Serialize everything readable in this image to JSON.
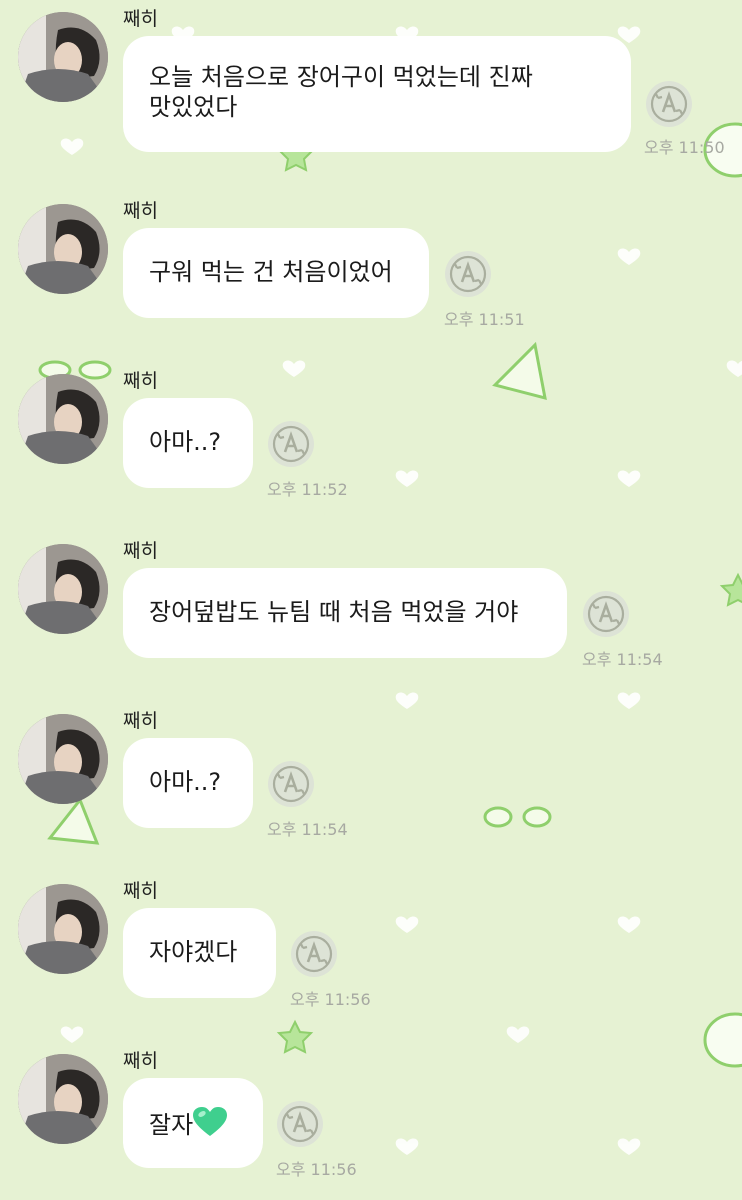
{
  "chat": {
    "messages": [
      {
        "sender": "째히",
        "text_lines": [
          "오늘 처음으로 장어구이 먹었는데 진짜",
          "맛있었다"
        ],
        "time": "오후 11:50"
      },
      {
        "sender": "째히",
        "text_lines": [
          "구워 먹는 건 처음이었어"
        ],
        "time": "오후 11:51"
      },
      {
        "sender": "째히",
        "text_lines": [
          "아마..?"
        ],
        "time": "오후 11:52"
      },
      {
        "sender": "째히",
        "text_lines": [
          "장어덮밥도 뉴팀 때 처음 먹었을 거야"
        ],
        "time": "오후 11:54"
      },
      {
        "sender": "째히",
        "text_lines": [
          "아마..?"
        ],
        "time": "오후 11:54"
      },
      {
        "sender": "째히",
        "text_lines": [
          "자야겠다"
        ],
        "time": "오후 11:56"
      },
      {
        "sender": "째히",
        "text_lines": [
          "잘자"
        ],
        "time": "오후 11:56",
        "emoji": "green-heart"
      }
    ]
  },
  "icons": {
    "translate": "translate-a-icon",
    "avatar": "profile-avatar"
  },
  "colors": {
    "background": "#e6f2d3",
    "bubble": "#ffffff",
    "timestamp": "#a7a9a2",
    "decoration": "#9fd37d",
    "heart": "#3fcf8e"
  }
}
